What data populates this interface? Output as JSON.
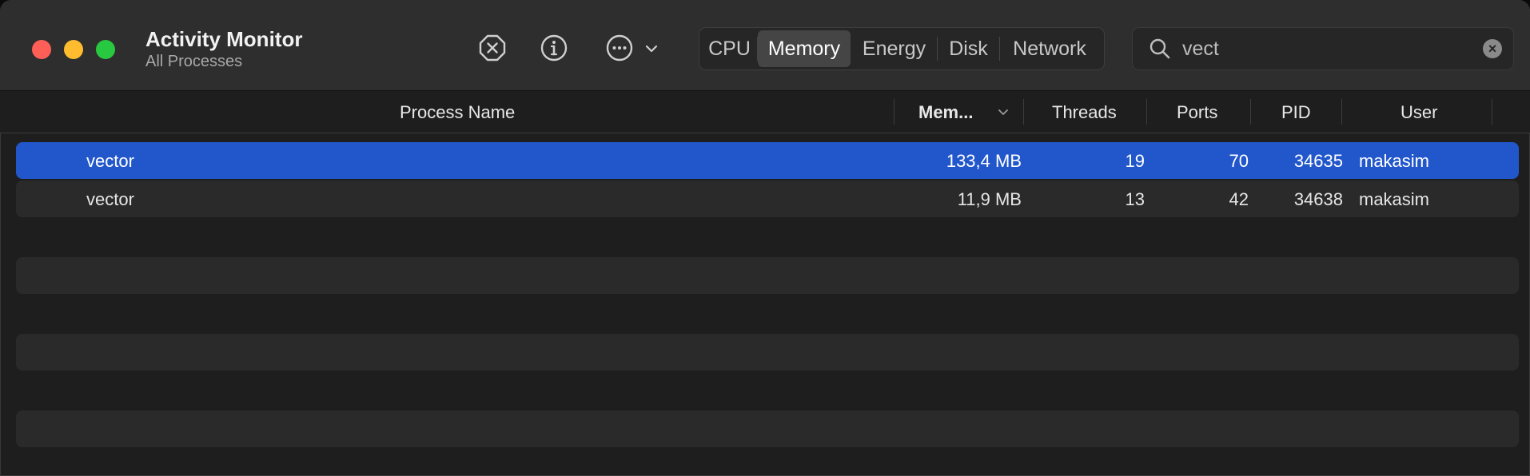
{
  "window": {
    "title": "Activity Monitor",
    "subtitle": "All Processes"
  },
  "toolbar": {
    "stop_icon": "stop-process-icon",
    "info_icon": "info-icon",
    "more_icon": "more-options-icon"
  },
  "tabs": [
    {
      "label": "CPU",
      "active": false
    },
    {
      "label": "Memory",
      "active": true
    },
    {
      "label": "Energy",
      "active": false
    },
    {
      "label": "Disk",
      "active": false
    },
    {
      "label": "Network",
      "active": false
    }
  ],
  "search": {
    "value": "vect"
  },
  "columns": {
    "process_name": "Process Name",
    "memory": "Mem...",
    "threads": "Threads",
    "ports": "Ports",
    "pid": "PID",
    "user": "User"
  },
  "processes": [
    {
      "name": "vector",
      "memory": "133,4 MB",
      "threads": "19",
      "ports": "70",
      "pid": "34635",
      "user": "makasim",
      "selected": true
    },
    {
      "name": "vector",
      "memory": "11,9 MB",
      "threads": "13",
      "ports": "42",
      "pid": "34638",
      "user": "makasim",
      "selected": false
    }
  ],
  "colors": {
    "selection": "#2257cc",
    "close": "#ff5f57",
    "minimize": "#febc2e",
    "maximize": "#28c840"
  }
}
